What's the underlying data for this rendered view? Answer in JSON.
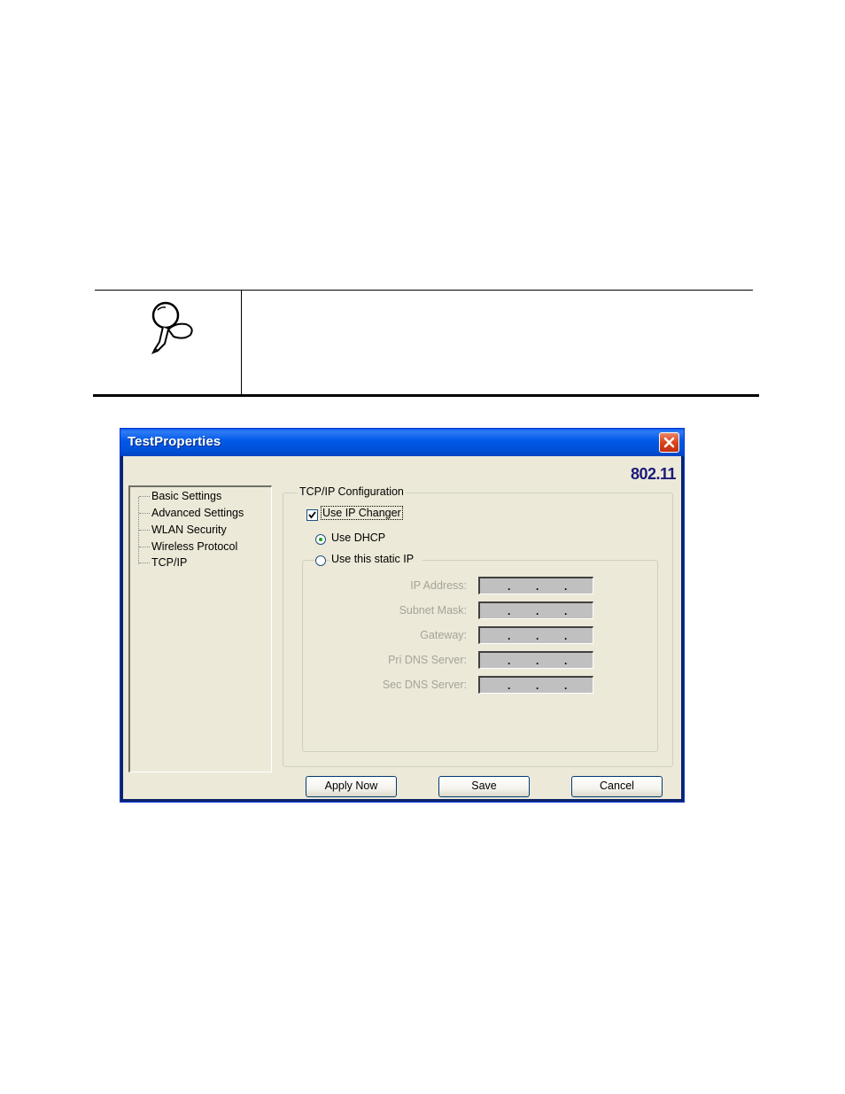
{
  "window": {
    "title": "TestProperties",
    "brand": "802.11"
  },
  "tree": {
    "items": [
      {
        "label": "Basic Settings"
      },
      {
        "label": "Advanced Settings"
      },
      {
        "label": "WLAN Security"
      },
      {
        "label": "Wireless Protocol"
      },
      {
        "label": "TCP/IP"
      }
    ]
  },
  "tcpip": {
    "group_title": "TCP/IP Configuration",
    "use_ip_changer_label": "Use IP Changer",
    "use_ip_changer_checked": true,
    "use_dhcp_label": "Use DHCP",
    "use_dhcp_selected": true,
    "use_static_label": "Use this static IP",
    "use_static_selected": false,
    "fields": [
      {
        "label": "IP Address:",
        "value": ". . ."
      },
      {
        "label": "Subnet Mask:",
        "value": ". . ."
      },
      {
        "label": "Gateway:",
        "value": ". . ."
      },
      {
        "label": "Pri DNS Server:",
        "value": ". . ."
      },
      {
        "label": "Sec DNS Server:",
        "value": ". . ."
      }
    ]
  },
  "buttons": {
    "apply_now": "Apply Now",
    "save": "Save",
    "cancel": "Cancel"
  },
  "colors": {
    "titlebar": "#0058e6",
    "close_button": "#d9451c",
    "dialog_bg": "#ece9d8",
    "brand_text": "#1a1a7a",
    "disabled_text": "#a6a39a"
  },
  "icons": {
    "note": "magnifier-hand-icon",
    "close": "close-icon",
    "checkbox": "checkmark-icon"
  }
}
